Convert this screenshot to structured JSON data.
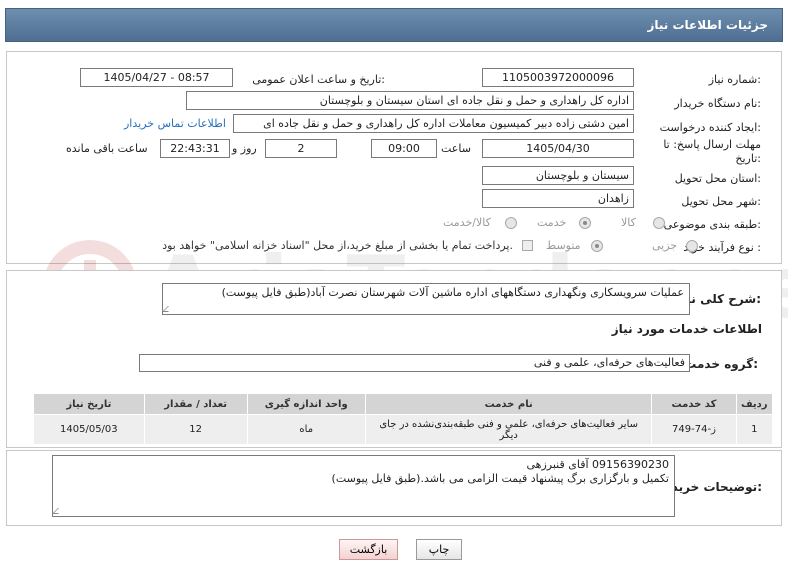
{
  "header": {
    "title": "جزئیات اطلاعات نیاز"
  },
  "form": {
    "need_number": {
      "label": "شماره نیاز:",
      "value": "1105003972000096"
    },
    "announce_datetime": {
      "label": "تاریخ و ساعت اعلان عمومی:",
      "value": "1405/04/27 - 08:57"
    },
    "buyer_org": {
      "label": "نام دستگاه خریدار:",
      "value": "اداره کل راهداری و حمل و نقل جاده ای استان سیستان و بلوچستان"
    },
    "requester": {
      "label": "ایجاد کننده درخواست:",
      "value": "امین دشتی زاده دبیر کمیسیون معاملات اداره کل راهداری و حمل و نقل جاده ای",
      "contact_link": "اطلاعات تماس خریدار"
    },
    "deadline": {
      "label_line1": "مهلت ارسال پاسخ: تا",
      "label_line2": "تاریخ:",
      "date": "1405/04/30",
      "time_label": "ساعت",
      "time": "09:00",
      "days": "2",
      "days_label": "روز و",
      "remaining": "22:43:31",
      "remaining_label": "ساعت باقی مانده"
    },
    "delivery_province": {
      "label": "استان محل تحویل:",
      "value": "سیستان و بلوچستان"
    },
    "delivery_city": {
      "label": "شهر محل تحویل:",
      "value": "زاهدان"
    },
    "category": {
      "label": "طبقه بندی موضوعی:",
      "options": {
        "goods": "کالا",
        "service": "خدمت",
        "goods_service": "کالا/خدمت"
      },
      "selected": "service"
    },
    "purchase_type": {
      "label": "نوع فرآیند خرید :",
      "options": {
        "partial": "جزیی",
        "medium": "متوسط"
      },
      "selected": "medium",
      "payment_note": "پرداخت تمام یا بخشی از مبلغ خرید،از محل \"اسناد خزانه اسلامی\" خواهد بود."
    }
  },
  "need_description": {
    "label": "شرح کلی نیاز:",
    "value": "عملیات سرویسکاری ونگهداری دستگاههای اداره ماشین آلات شهرستان نصرت آباد(طبق فایل پیوست)"
  },
  "services_section": {
    "title": "اطلاعات خدمات مورد نیاز",
    "group_label": "گروه خدمت:",
    "group_value": "فعالیت‌های حرفه‌ای، علمی و فنی"
  },
  "table": {
    "headers": {
      "row": "ردیف",
      "code": "کد خدمت",
      "name": "نام خدمت",
      "unit": "واحد اندازه گیری",
      "qty": "تعداد / مقدار",
      "date": "تاریخ نیاز"
    },
    "rows": [
      {
        "row": "1",
        "code": "ز-74-749",
        "name": "سایر فعالیت‌های حرفه‌ای، علمی و فنی طبقه‌بندی‌نشده در جای دیگر",
        "unit": "ماه",
        "qty": "12",
        "date": "1405/05/03"
      }
    ]
  },
  "buyer_notes": {
    "label": "توضیحات خریدار:",
    "line1": "09156390230  آقای  قنبرزهی",
    "line2": "تکمیل و بارگزاری برگ پیشنهاد قیمت الزامی می باشد.(طبق فایل پیوست)"
  },
  "buttons": {
    "print": "چاپ",
    "back": "بازگشت"
  },
  "watermark": {
    "text": "AriaTender.neT"
  },
  "colors": {
    "header": "#5b7ba0",
    "link": "#2a6ebb",
    "table_header": "#d4d4d4",
    "back_button": "#f3d2d2"
  }
}
